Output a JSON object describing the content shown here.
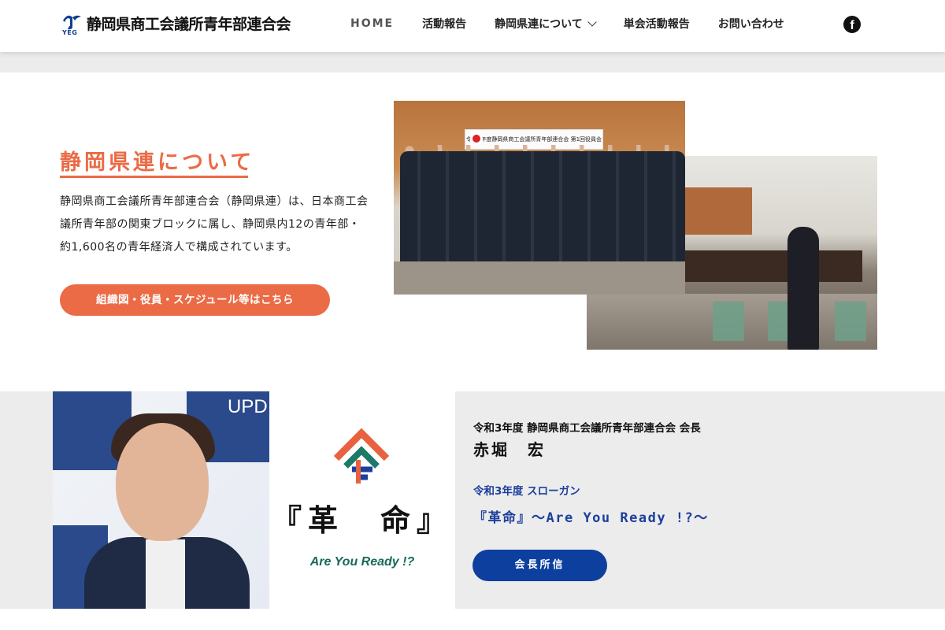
{
  "header": {
    "logo_text": "静岡県商工会議所青年部連合会",
    "logo_sub": "YEG",
    "nav": [
      {
        "label": "HOME"
      },
      {
        "label": "活動報告"
      },
      {
        "label": "静岡県連について"
      },
      {
        "label": "単会活動報告"
      },
      {
        "label": "お問い合わせ"
      }
    ],
    "facebook_glyph": "f"
  },
  "about": {
    "title": "静岡県連について",
    "body": "静岡県商工会議所青年部連合会（静岡県連）は、日本商工会議所青年部の関東ブロックに属し、静岡県内12の青年部・約1,600名の青年経済人で構成されています。",
    "button": "組織図・役員・スケジュール等はこちら",
    "photo_banner": "令和3年度静岡県商工会議所青年部連合会 第1回役員会"
  },
  "chair": {
    "photo_sign": "UPD",
    "kakumei": "『革　命』",
    "kakumei_sub": "Are You Ready !?",
    "subtitle": "令和3年度 静岡県商工会議所青年部連合会 会長",
    "name": "赤堀　宏",
    "slogan_label": "令和3年度 スローガン",
    "slogan": "『革命』〜Are You Ready !?〜",
    "button": "会長所信"
  },
  "colors": {
    "accent_orange": "#ea6b46",
    "accent_blue": "#0d3f9f",
    "slogan_blue": "#1c3f9b",
    "kakumei_green": "#176a5c"
  }
}
